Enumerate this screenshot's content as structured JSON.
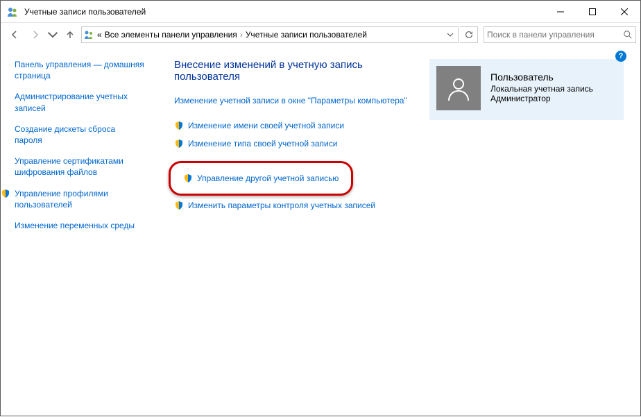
{
  "window": {
    "title": "Учетные записи пользователей"
  },
  "breadcrumb": {
    "prefix": "«",
    "parent": "Все элементы панели управления",
    "current": "Учетные записи пользователей"
  },
  "search": {
    "placeholder": "Поиск в панели управления"
  },
  "sidebar": {
    "items": [
      {
        "label": "Панель управления — домашняя страница",
        "shield": false
      },
      {
        "label": "Администрирование учетных записей",
        "shield": false
      },
      {
        "label": "Создание дискеты сброса пароля",
        "shield": false
      },
      {
        "label": "Управление сертификатами шифрования файлов",
        "shield": false
      },
      {
        "label": "Управление профилями пользователей",
        "shield": true
      },
      {
        "label": "Изменение переменных среды",
        "shield": false
      }
    ]
  },
  "main": {
    "heading": "Внесение изменений в учетную запись пользователя",
    "tasks": [
      {
        "label": "Изменение учетной записи в окне \"Параметры компьютера\"",
        "shield": false
      },
      {
        "label": "Изменение имени своей учетной записи",
        "shield": true
      },
      {
        "label": "Изменение типа своей учетной записи",
        "shield": true
      },
      {
        "label": "Управление другой учетной записью",
        "shield": true,
        "highlighted": true
      },
      {
        "label": "Изменить параметры контроля учетных записей",
        "shield": true
      }
    ]
  },
  "user": {
    "name": "Пользователь",
    "type": "Локальная учетная запись",
    "role": "Администратор"
  },
  "help": "?"
}
